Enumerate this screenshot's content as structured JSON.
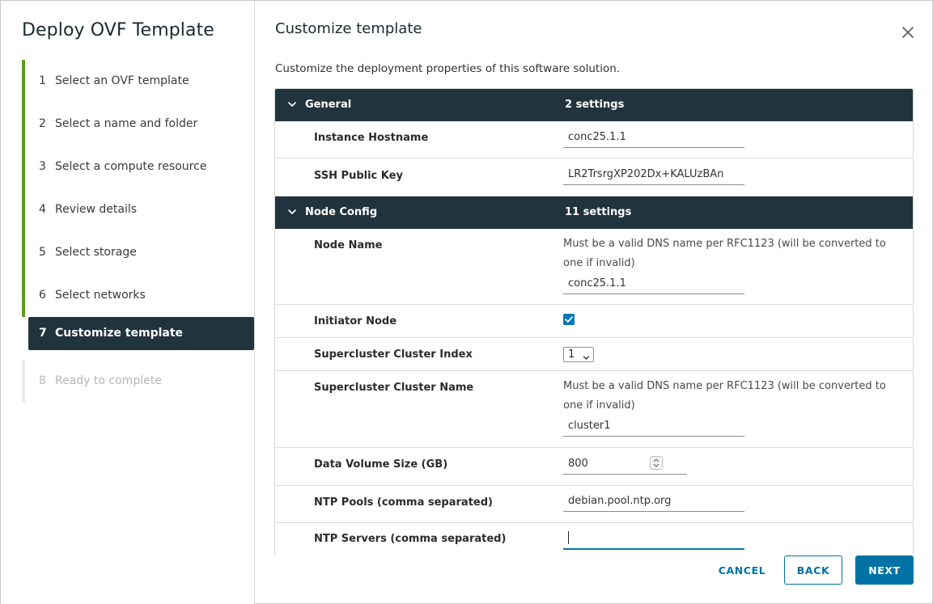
{
  "wizard": {
    "title": "Deploy OVF Template",
    "steps": [
      {
        "num": "1",
        "label": "Select an OVF template"
      },
      {
        "num": "2",
        "label": "Select a name and folder"
      },
      {
        "num": "3",
        "label": "Select a compute resource"
      },
      {
        "num": "4",
        "label": "Review details"
      },
      {
        "num": "5",
        "label": "Select storage"
      },
      {
        "num": "6",
        "label": "Select networks"
      },
      {
        "num": "7",
        "label": "Customize template"
      },
      {
        "num": "8",
        "label": "Ready to complete"
      }
    ],
    "active_step": 7
  },
  "main": {
    "title": "Customize template",
    "subtitle": "Customize the deployment properties of this software solution."
  },
  "groups": {
    "general": {
      "name": "General",
      "count": "2 settings",
      "instance_hostname": {
        "label": "Instance Hostname",
        "value": "conc25.1.1"
      },
      "ssh_public_key": {
        "label": "SSH Public Key",
        "value": "LR2TrsrgXP202Dx+KALUzBAn"
      }
    },
    "node_config": {
      "name": "Node Config",
      "count": "11 settings",
      "node_name": {
        "label": "Node Name",
        "description": "Must be a valid DNS name per RFC1123 (will be converted to one if invalid)",
        "value": "conc25.1.1"
      },
      "initiator_node": {
        "label": "Initiator Node",
        "checked": true
      },
      "supercluster_index": {
        "label": "Supercluster Cluster Index",
        "value": "1"
      },
      "supercluster_name": {
        "label": "Supercluster Cluster Name",
        "description": "Must be a valid DNS name per RFC1123 (will be converted to one if invalid)",
        "value": "cluster1"
      },
      "data_volume_size": {
        "label": "Data Volume Size (GB)",
        "value": "800"
      },
      "ntp_pools": {
        "label": "NTP Pools (comma separated)",
        "value": "debian.pool.ntp.org"
      },
      "ntp_servers": {
        "label": "NTP Servers (comma separated)",
        "value": ""
      }
    }
  },
  "footer": {
    "cancel_label": "CANCEL",
    "back_label": "BACK",
    "next_label": "NEXT"
  },
  "colors": {
    "completed_bar": "#5f9a1e",
    "active_step_bg": "#21333d",
    "group_header_bg": "#21333d",
    "accent": "#0072a3",
    "checkbox": "#0079b8"
  },
  "icons": {
    "close": "close-icon",
    "group_toggle": "chevron-down-icon",
    "checkbox": "checkmark-icon",
    "select": "chevron-down-icon",
    "spinner": "spinner-arrows-icon"
  }
}
